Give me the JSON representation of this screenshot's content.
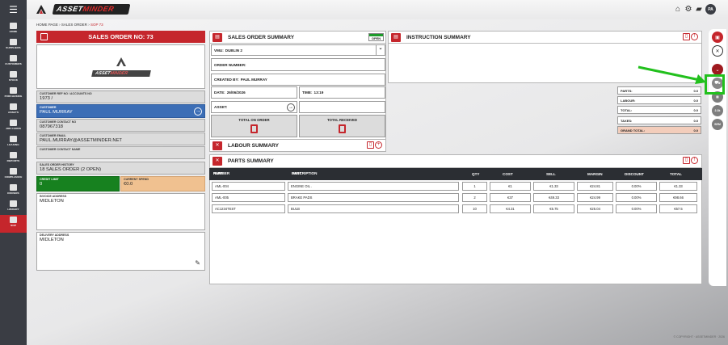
{
  "app": {
    "logo_prefix": "ASSET",
    "logo_suffix": "MINDER",
    "user_initials": "PA"
  },
  "header": {
    "icons": [
      "home-icon",
      "gear-icon",
      "truck-icon"
    ]
  },
  "sidebar": {
    "items": [
      {
        "label": "HOME",
        "icon": "home-icon"
      },
      {
        "label": "SUPPLIERS",
        "icon": "suppliers-icon"
      },
      {
        "label": "CUSTOMERS",
        "icon": "customers-icon"
      },
      {
        "label": "STOCK",
        "icon": "stock-icon"
      },
      {
        "label": "PURCHASING",
        "icon": "purchasing-icon"
      },
      {
        "label": "ASSETS",
        "icon": "assets-icon"
      },
      {
        "label": "JOB CARDS",
        "icon": "job-cards-icon"
      },
      {
        "label": "LEASING",
        "icon": "leasing-icon"
      },
      {
        "label": "REPORTS",
        "icon": "reports-icon"
      },
      {
        "label": "COMPLIANCE",
        "icon": "compliance-icon"
      },
      {
        "label": "DRIVERS",
        "icon": "drivers-icon"
      },
      {
        "label": "LIBRARY",
        "icon": "library-icon"
      },
      {
        "label": "SOP",
        "icon": "sop-icon"
      }
    ]
  },
  "breadcrumb": {
    "home": "HOME PAGE",
    "sep1": " › ",
    "section": "SALES ORDER",
    "sep2": " › ",
    "current": "SOP 73"
  },
  "sales_order": {
    "title": "SALES ORDER NO: 73",
    "customer_ref_label": "CUSTOMER REF NO / ACCOUNTS NO",
    "customer_ref_value": "1973 /",
    "customer_label": "CUSTOMER",
    "customer_value": "PAUL MURRAY",
    "contact_no_label": "CUSTOMER CONTACT NO",
    "contact_no_value": "087967318",
    "email_label": "CUSTOMER EMAIL",
    "email_value": "PAUL.MURRAY@ASSETMINDER.NET",
    "contact_name_label": "CUSTOMER CONTACT NAME",
    "contact_name_value": "",
    "history_label": "SALES ORDER HISTORY",
    "history_value": "18 SALES ORDER (2 OPEN)",
    "credit_limit_label": "CREDIT LIMIT",
    "credit_limit_value": "0",
    "current_spend_label": "CURRENT SPEND",
    "current_spend_value": "€0.0",
    "invoice_address_label": "INVOICE ADDRESS",
    "invoice_address_value": "MIDLETON",
    "delivery_address_label": "DELIVERY ADDRESS",
    "delivery_address_value": "MIDLETON"
  },
  "summary": {
    "title": "SALES ORDER SUMMARY",
    "status": "OPEN",
    "vmu_label": "VMU:",
    "vmu_value": "DUBLIN 2",
    "order_number_label": "ORDER NUMBER:",
    "order_number_value": "",
    "created_by_label": "CREATED BY:",
    "created_by_value": "PAUL MURRAY",
    "date_label": "DATE:",
    "date_value": "26/06/2026",
    "time_label": "TIME:",
    "time_value": "13:19",
    "asset_label": "ASSET:",
    "asset_value": "",
    "total_on_order_label": "TOTAL ON ORDER",
    "total_on_order_value": 0,
    "total_received_label": "TOTAL RECEIVED",
    "total_received_value": 0
  },
  "instruction": {
    "title": "INSTRUCTION SUMMARY",
    "text": ""
  },
  "totals": [
    {
      "label": "PARTS:",
      "value": "0.0"
    },
    {
      "label": "LABOUR:",
      "value": "0.0"
    },
    {
      "label": "TOTAL:",
      "value": "0.0"
    },
    {
      "label": "TAXES:",
      "value": "0.0"
    },
    {
      "label": "GRAND TOTAL:",
      "value": "0.0"
    }
  ],
  "labour": {
    "title": "LABOUR SUMMARY"
  },
  "parts": {
    "title": "PARTS SUMMARY",
    "columns": {
      "part_number_1": "PART",
      "part_number_2": "NUMBER",
      "description_1": "PART",
      "description_2": "DESCRIPTION",
      "qty": "QTY",
      "cost": "COST",
      "sell": "SELL",
      "margin": "MARGIN",
      "discount": "DISCOUNT",
      "total": "TOTAL"
    },
    "rows": [
      {
        "part_number": "AML-004",
        "description": "ENGINE OIL .",
        "qty": "1",
        "cost": "€1",
        "sell": "€1.33",
        "margin": "€24.81",
        "discount": "0.00%",
        "total": "€1.33"
      },
      {
        "part_number": "AML-005",
        "description": "BRAKE PADS",
        "qty": "2",
        "cost": "€37",
        "sell": "€49.33",
        "margin": "€24.99",
        "discount": "0.00%",
        "total": "€98.66"
      },
      {
        "part_number": "AC1234TEST",
        "description": "BULB",
        "qty": "10",
        "cost": "€4.31",
        "sell": "€5.75",
        "margin": "€25.04",
        "discount": "0.00%",
        "total": "€57.5"
      }
    ]
  },
  "rail": {
    "buttons": [
      {
        "icon": "save-icon"
      },
      {
        "icon": "close-icon"
      },
      {
        "icon": "chevron-down-icon"
      },
      {
        "icon": "cart-icon"
      },
      {
        "icon": "document-icon"
      },
      {
        "label": "2.3k"
      },
      {
        "label": "SEM"
      }
    ]
  },
  "footer": {
    "copyright": "© COPYRIGHT · ASSETMINDER · 2026"
  }
}
